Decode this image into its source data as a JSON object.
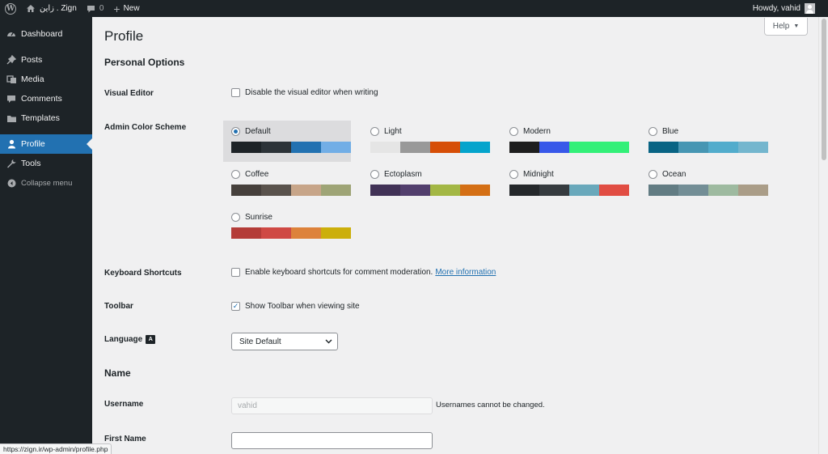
{
  "adminbar": {
    "site_name": "زاین . Zign",
    "comments_count": "0",
    "new_label": "New",
    "howdy": "Howdy, vahid"
  },
  "sidebar": {
    "items": [
      {
        "label": "Dashboard",
        "icon": "dashboard-icon"
      },
      {
        "label": "Posts",
        "icon": "pin-icon"
      },
      {
        "label": "Media",
        "icon": "media-icon"
      },
      {
        "label": "Comments",
        "icon": "comment-icon"
      },
      {
        "label": "Templates",
        "icon": "folder-icon"
      },
      {
        "label": "Profile",
        "icon": "user-icon",
        "current": true
      },
      {
        "label": "Tools",
        "icon": "wrench-icon"
      }
    ],
    "collapse_label": "Collapse menu"
  },
  "page": {
    "title": "Profile",
    "help_label": "Help"
  },
  "personal_options": {
    "heading": "Personal Options",
    "visual_editor": {
      "label": "Visual Editor",
      "checkbox_text": "Disable the visual editor when writing",
      "checked": false
    },
    "color_scheme": {
      "label": "Admin Color Scheme",
      "schemes": [
        {
          "name": "Default",
          "selected": true,
          "colors": [
            "#1d2327",
            "#2c3338",
            "#2271b1",
            "#72aee6"
          ]
        },
        {
          "name": "Light",
          "selected": false,
          "colors": [
            "#e5e5e5",
            "#999999",
            "#d64e07",
            "#04a4cc"
          ]
        },
        {
          "name": "Modern",
          "selected": false,
          "colors": [
            "#1e1e1e",
            "#3858e9",
            "#33f078",
            "#33f078"
          ]
        },
        {
          "name": "Blue",
          "selected": false,
          "colors": [
            "#096484",
            "#4796b3",
            "#52accc",
            "#74b6ce"
          ]
        },
        {
          "name": "Coffee",
          "selected": false,
          "colors": [
            "#46403c",
            "#59524c",
            "#c7a589",
            "#9ea476"
          ]
        },
        {
          "name": "Ectoplasm",
          "selected": false,
          "colors": [
            "#413256",
            "#523f6d",
            "#a3b745",
            "#d46f15"
          ]
        },
        {
          "name": "Midnight",
          "selected": false,
          "colors": [
            "#25282b",
            "#363b3f",
            "#69a8bb",
            "#e14d43"
          ]
        },
        {
          "name": "Ocean",
          "selected": false,
          "colors": [
            "#627c83",
            "#738e96",
            "#9ebaa0",
            "#aa9d88"
          ]
        },
        {
          "name": "Sunrise",
          "selected": false,
          "colors": [
            "#b43c38",
            "#cf4944",
            "#dd823b",
            "#ccaf0b"
          ]
        }
      ]
    },
    "keyboard_shortcuts": {
      "label": "Keyboard Shortcuts",
      "checkbox_text": "Enable keyboard shortcuts for comment moderation.",
      "link_text": "More information",
      "checked": false
    },
    "toolbar": {
      "label": "Toolbar",
      "checkbox_text": "Show Toolbar when viewing site",
      "checked": true
    },
    "language": {
      "label": "Language",
      "selected": "Site Default"
    }
  },
  "name_section": {
    "heading": "Name",
    "username": {
      "label": "Username",
      "value": "vahid",
      "hint": "Usernames cannot be changed."
    },
    "first_name": {
      "label": "First Name",
      "value": ""
    }
  },
  "status_url": "https://zign.ir/wp-admin/profile.php"
}
